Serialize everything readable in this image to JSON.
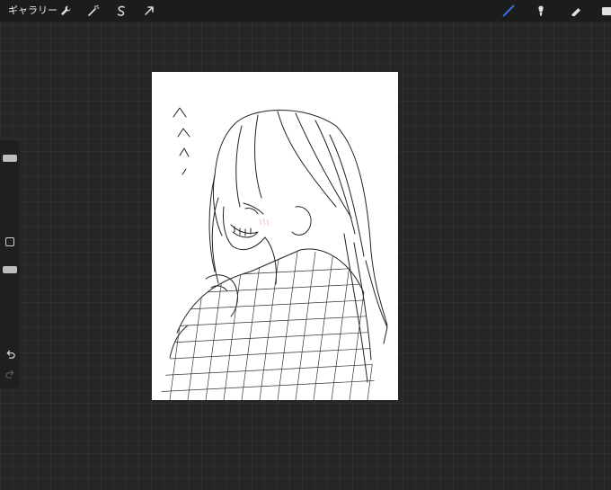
{
  "topbar": {
    "gallery_label": "ギャラリー",
    "left_tools": [
      "wrench-icon",
      "magic-wand-icon",
      "selection-icon",
      "transform-icon"
    ],
    "right_tools": [
      "brush-icon",
      "smudge-icon",
      "eraser-icon",
      "layers-icon"
    ],
    "active_tool": "brush-icon"
  },
  "sidebar": {
    "brush_size": 0.1,
    "opacity": 0.1
  },
  "colors": {
    "background": "#262626",
    "topbar": "#1c1c1c",
    "canvas": "#ffffff",
    "active_brush": "#3d7bf5",
    "icon": "#e0e0e0",
    "blush": "#f0b9c8"
  }
}
